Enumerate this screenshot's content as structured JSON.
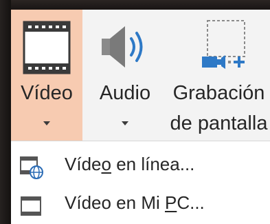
{
  "ribbon": {
    "buttons": [
      {
        "id": "video",
        "label": "Vídeo",
        "icon": "film-strip-icon",
        "selected": true
      },
      {
        "id": "audio",
        "label": "Audio",
        "icon": "speaker-icon"
      },
      {
        "id": "screen_recording",
        "label_line1": "Grabación",
        "label_line2": "de pantalla",
        "icon": "screen-recording-icon"
      }
    ]
  },
  "menu": {
    "items": [
      {
        "label_pre": "Víde",
        "label_access": "o",
        "label_post": " en línea...",
        "icon": "online-video-icon"
      },
      {
        "label_pre": "Vídeo en Mi ",
        "label_access": "P",
        "label_post": "C...",
        "icon": "film-strip-small-icon"
      }
    ]
  },
  "colors": {
    "selected_bg": "#f7cbb1",
    "ribbon_bg": "#f3f3f3",
    "speaker_blue": "#2e79c6",
    "globe_blue": "#2b6cb5"
  }
}
